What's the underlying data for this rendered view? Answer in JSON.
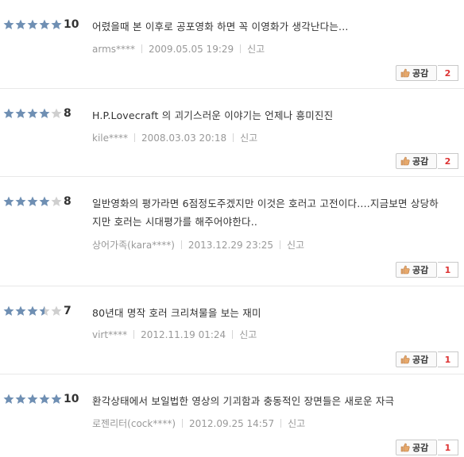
{
  "reviews": [
    {
      "rating": 5,
      "score": "10",
      "text": "어렸을때 본 이후로 공포영화 하면 꼭 이영화가 생각난다는...",
      "user": "arms****",
      "date": "2009.05.05 19:29",
      "report": "신고",
      "like_label": "공감",
      "like_count": "2"
    },
    {
      "rating": 4,
      "score": "8",
      "text": "H.P.Lovecraft 의 괴기스러운 이야기는 언제나 흥미진진",
      "user": "kile****",
      "date": "2008.03.03 20:18",
      "report": "신고",
      "like_label": "공감",
      "like_count": "2"
    },
    {
      "rating": 4,
      "score": "8",
      "text": "일반영화의 평가라면 6점정도주겠지만 이것은 호러고 고전이다....지금보면 상당하\n지만 호러는 시대평가를 해주어야한다..",
      "user": "상어가족(kara****)",
      "date": "2013.12.29 23:25",
      "report": "신고",
      "like_label": "공감",
      "like_count": "1"
    },
    {
      "rating": 3.5,
      "score": "7",
      "text": "80년대 명작 호러 크리쳐물을 보는 재미",
      "user": "virt****",
      "date": "2012.11.19 01:24",
      "report": "신고",
      "like_label": "공감",
      "like_count": "1"
    },
    {
      "rating": 5,
      "score": "10",
      "text": "환각상태에서 보일법한 영상의 기괴함과 충동적인 장면들은 새로운 자극",
      "user": "로젠리터(cock****)",
      "date": "2012.09.25 14:57",
      "report": "신고",
      "like_label": "공감",
      "like_count": "1"
    }
  ],
  "colors": {
    "star_filled": "#6f8fb3",
    "star_empty": "#cfcfcf",
    "like_count": "#dd3333"
  }
}
